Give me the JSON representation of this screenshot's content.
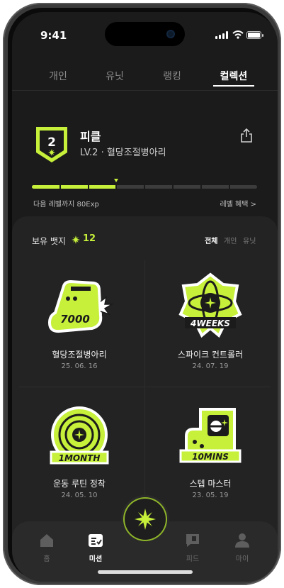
{
  "status": {
    "time": "9:41"
  },
  "tabs": [
    {
      "label": "개인"
    },
    {
      "label": "유닛"
    },
    {
      "label": "랭킹"
    },
    {
      "label": "컬렉션"
    }
  ],
  "profile": {
    "level_number": "2",
    "name": "피클",
    "subtitle": "LV.2 · 혈당조절병아리",
    "progress": 0.37,
    "next_level": "다음 레벨까지 80Exp",
    "benefit": "레벨 혜택 >"
  },
  "badges_header": {
    "label": "보유 뱃지",
    "count": "12",
    "filters": [
      "전체",
      "개인",
      "유닛"
    ]
  },
  "badges": [
    {
      "name": "혈당조절병아리",
      "date": "25. 06. 16",
      "art_text": "7000",
      "icon": "sneaker-badge-icon"
    },
    {
      "name": "스파이크 컨트롤러",
      "date": "24. 07. 19",
      "art_text": "4WEEKS",
      "icon": "atom-badge-icon"
    },
    {
      "name": "운동 루틴 정착",
      "date": "24. 05. 10",
      "art_text": "1MONTH",
      "icon": "target-badge-icon"
    },
    {
      "name": "스텝 마스터",
      "date": "23. 05. 19",
      "art_text": "10MINS",
      "icon": "timer-badge-icon"
    }
  ],
  "nav": [
    {
      "label": "홈",
      "icon": "home-icon"
    },
    {
      "label": "미션",
      "icon": "mission-icon"
    },
    {
      "label": "피드",
      "icon": "feed-icon"
    },
    {
      "label": "마이",
      "icon": "profile-icon"
    }
  ],
  "colors": {
    "accent": "#c6f03a",
    "background": "#1b1b1b",
    "panel": "#232323"
  }
}
